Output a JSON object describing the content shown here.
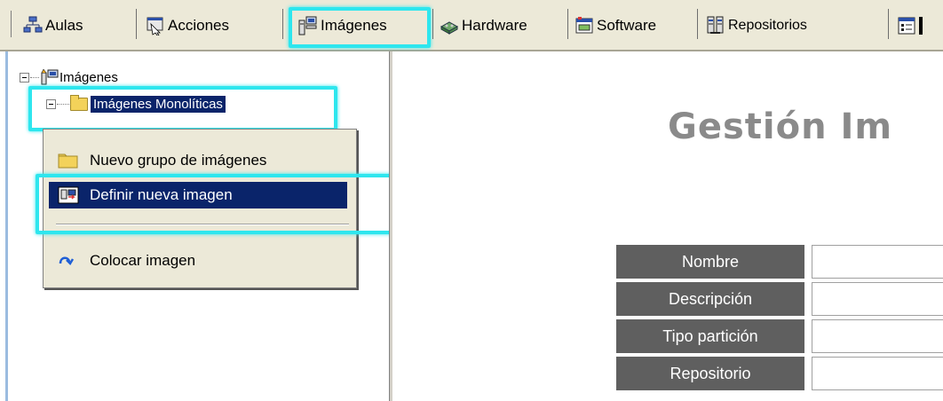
{
  "toolbar": {
    "items": [
      {
        "label": "Aulas",
        "icon": "classrooms-icon"
      },
      {
        "label": "Acciones",
        "icon": "actions-icon"
      },
      {
        "label": "Imágenes",
        "icon": "images-icon"
      },
      {
        "label": "Hardware",
        "icon": "hardware-icon"
      },
      {
        "label": "Software",
        "icon": "software-icon"
      },
      {
        "label": "Repositorios",
        "icon": "repositories-icon"
      }
    ]
  },
  "tree": {
    "root_label": "Imágenes",
    "child_label": "Imágenes Monolíticas"
  },
  "context_menu": {
    "items": [
      {
        "label": "Nuevo grupo de imágenes",
        "icon": "folder-icon"
      },
      {
        "label": "Definir nueva imagen",
        "icon": "new-image-icon"
      },
      {
        "label": "Colocar imagen",
        "icon": "place-image-icon"
      }
    ]
  },
  "main": {
    "title": "Gestión Im",
    "form_fields": [
      {
        "label": "Nombre"
      },
      {
        "label": "Descripción"
      },
      {
        "label": "Tipo partición"
      },
      {
        "label": "Repositorio"
      }
    ]
  },
  "colors": {
    "highlight": "#2ee6ee",
    "selection": "#0a246a",
    "form_label_bg": "#5f5f5f",
    "title": "#8a8a8a"
  }
}
